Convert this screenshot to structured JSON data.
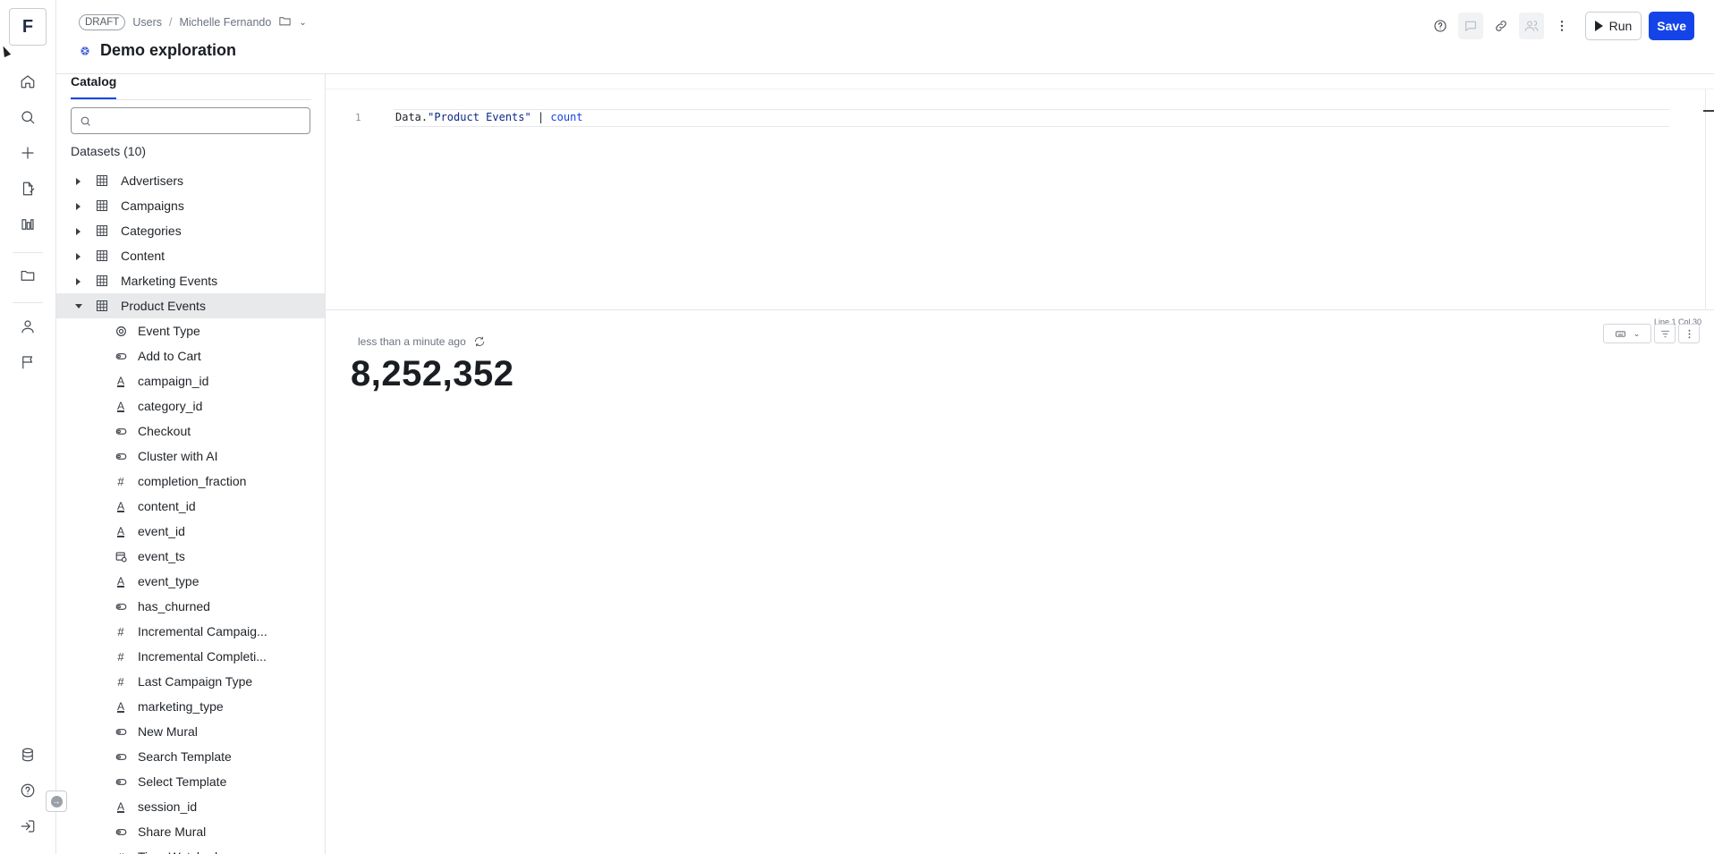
{
  "app": {
    "logo_letter": "F"
  },
  "breadcrumb": {
    "status": "DRAFT",
    "section": "Users",
    "owner": "Michelle Fernando",
    "separator": "/"
  },
  "page": {
    "title": "Demo exploration"
  },
  "toolbar": {
    "run_label": "Run",
    "save_label": "Save"
  },
  "sidebar": {
    "tab": "Catalog",
    "search_placeholder": "",
    "datasets_heading": "Datasets (10)",
    "datasets": [
      {
        "label": "Advertisers",
        "expanded": false
      },
      {
        "label": "Campaigns",
        "expanded": false
      },
      {
        "label": "Categories",
        "expanded": false
      },
      {
        "label": "Content",
        "expanded": false
      },
      {
        "label": "Marketing Events",
        "expanded": false
      },
      {
        "label": "Product Events",
        "expanded": true
      }
    ],
    "fields": [
      {
        "label": "Event Type",
        "icon": "dimension-group-icon"
      },
      {
        "label": "Add to Cart",
        "icon": "boolean-icon"
      },
      {
        "label": "campaign_id",
        "icon": "text-icon"
      },
      {
        "label": "category_id",
        "icon": "text-icon"
      },
      {
        "label": "Checkout",
        "icon": "boolean-icon"
      },
      {
        "label": "Cluster with AI",
        "icon": "boolean-icon"
      },
      {
        "label": "completion_fraction",
        "icon": "number-icon"
      },
      {
        "label": "content_id",
        "icon": "text-icon"
      },
      {
        "label": "event_id",
        "icon": "text-icon"
      },
      {
        "label": "event_ts",
        "icon": "datetime-icon"
      },
      {
        "label": "event_type",
        "icon": "text-icon"
      },
      {
        "label": "has_churned",
        "icon": "boolean-icon"
      },
      {
        "label": "Incremental Campaig...",
        "icon": "number-icon"
      },
      {
        "label": "Incremental Completi...",
        "icon": "number-icon"
      },
      {
        "label": "Last Campaign Type",
        "icon": "number-icon"
      },
      {
        "label": "marketing_type",
        "icon": "text-icon"
      },
      {
        "label": "New Mural",
        "icon": "boolean-icon"
      },
      {
        "label": "Search Template",
        "icon": "boolean-icon"
      },
      {
        "label": "Select Template",
        "icon": "boolean-icon"
      },
      {
        "label": "session_id",
        "icon": "text-icon"
      },
      {
        "label": "Share Mural",
        "icon": "boolean-icon"
      },
      {
        "label": "Time Watched",
        "icon": "number-icon"
      }
    ]
  },
  "editor": {
    "line_number": "1",
    "code_prefix": "Data.",
    "code_string": "\"Product Events\"",
    "code_pipe": " | ",
    "code_keyword": "count",
    "cursor_status": "Line 1 Col 30"
  },
  "result": {
    "updated": "less than a minute ago",
    "value": "8,252,352"
  },
  "colors": {
    "accent": "#1444e8",
    "selected_row": "#e8e9eb"
  }
}
